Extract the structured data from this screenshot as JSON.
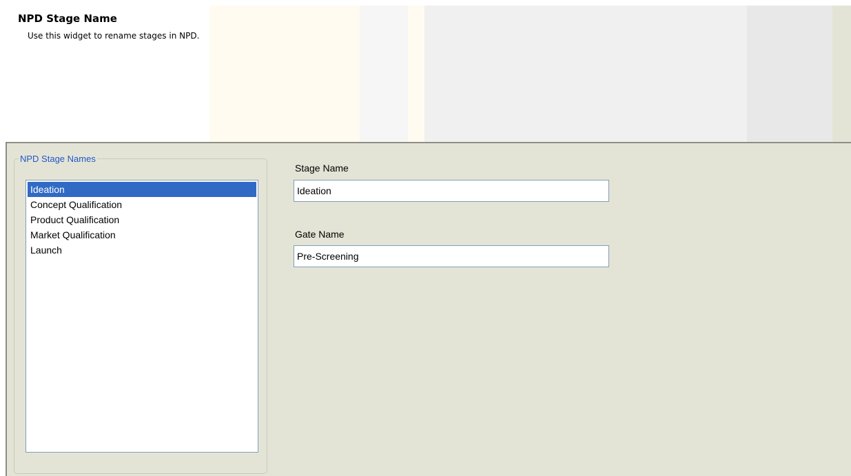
{
  "header": {
    "title": "NPD Stage Name",
    "description": "Use this widget to rename stages in NPD."
  },
  "stage_list": {
    "legend": "NPD Stage Names",
    "items": [
      {
        "label": "Ideation",
        "selected": true
      },
      {
        "label": "Concept Qualification",
        "selected": false
      },
      {
        "label": "Product Qualification",
        "selected": false
      },
      {
        "label": "Market Qualification",
        "selected": false
      },
      {
        "label": "Launch",
        "selected": false
      }
    ]
  },
  "form": {
    "stage_name_label": "Stage Name",
    "stage_name_value": "Ideation",
    "gate_name_label": "Gate Name",
    "gate_name_value": "Pre-Screening"
  },
  "colors": {
    "panel_background": "#e4e4d6",
    "selection": "#316ac5",
    "legend_text": "#2157c8",
    "input_border": "#7f9db9"
  }
}
